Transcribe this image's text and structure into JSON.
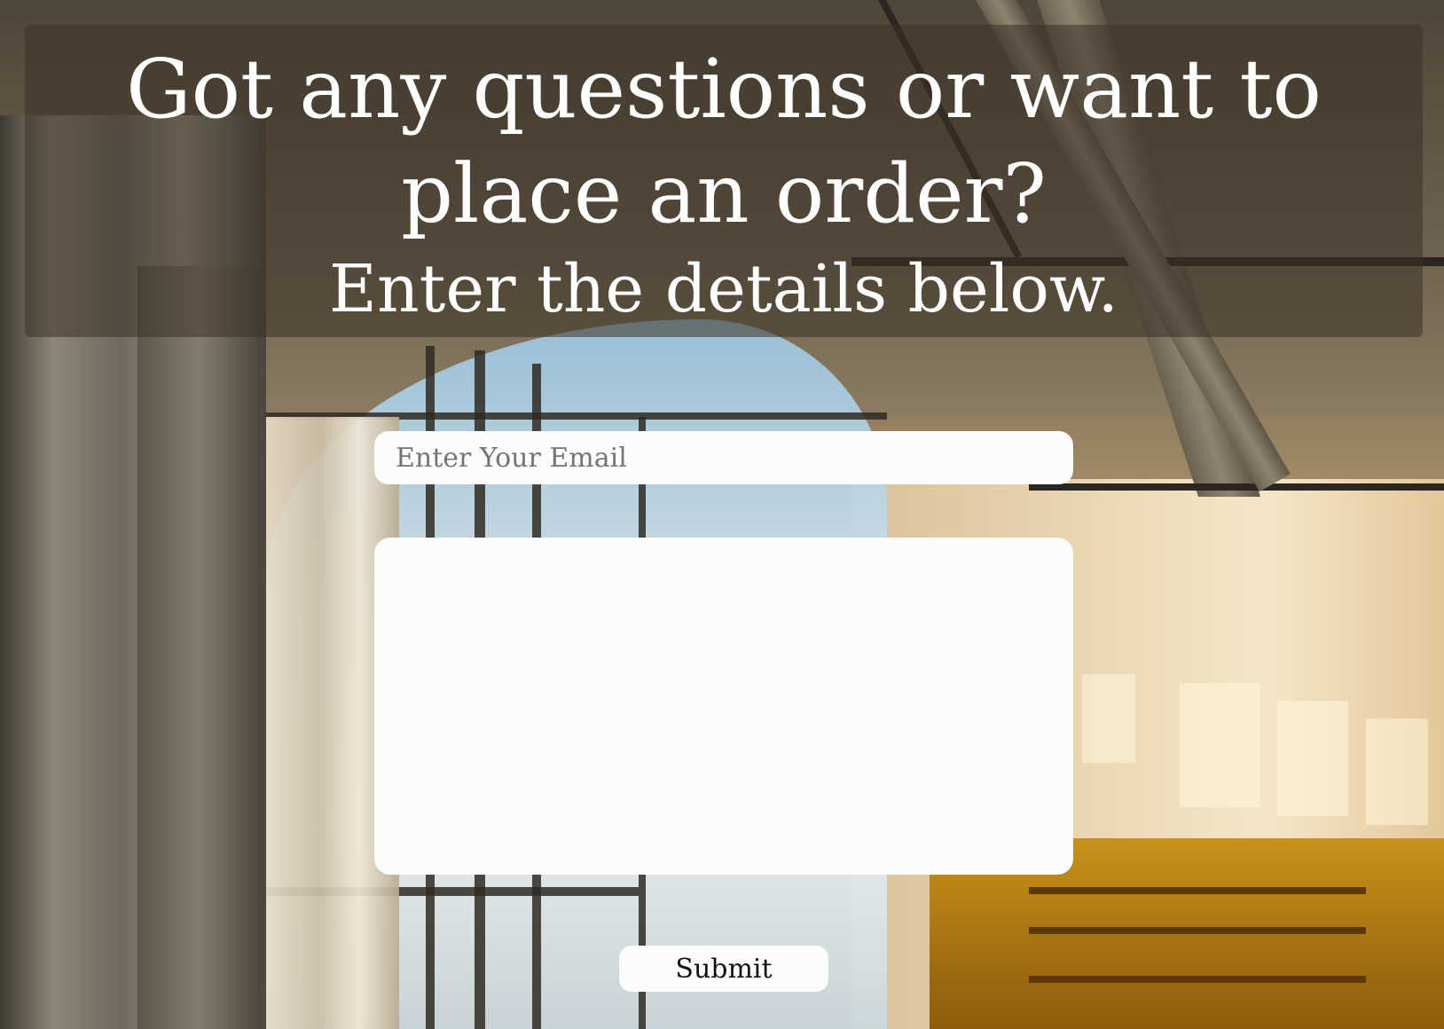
{
  "header": {
    "headline": "Got any questions or want to place an order?",
    "subheadline": "Enter the details below."
  },
  "form": {
    "email_placeholder": "Enter Your Email",
    "email_value": "",
    "message_placeholder": "",
    "message_value": "",
    "submit_label": "Submit"
  },
  "colors": {
    "overlay": "#3c3226",
    "input_bg": "#fcfcfb",
    "heading_text": "#ffffff"
  }
}
